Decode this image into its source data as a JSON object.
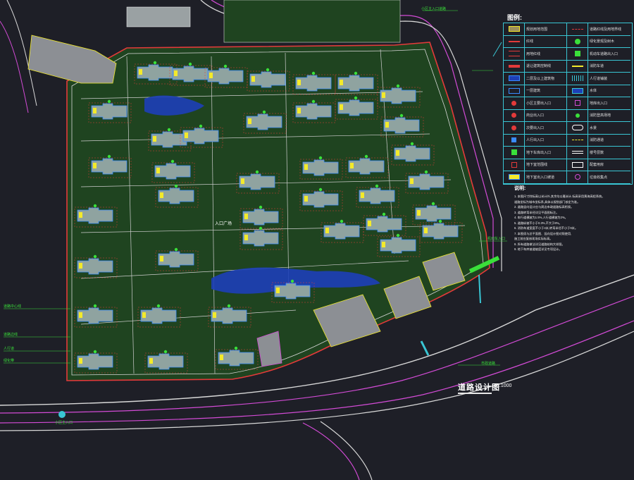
{
  "drawing": {
    "title": "道路设计图",
    "scale": "1:1000"
  },
  "legend": {
    "title": "图例:",
    "rows": [
      {
        "left_symbol": "plot-fill-icon",
        "left_label": "规划用地范围",
        "right_symbol": "dashed-line-icon",
        "right_label": "道路红线及用地界线"
      },
      {
        "left_symbol": "red-line-icon",
        "left_label": "红线",
        "right_symbol": "tree-icon",
        "right_label": "绿化景观及树木"
      },
      {
        "left_symbol": "red-double-line-icon",
        "left_label": "用地红线",
        "right_symbol": "green-arrow-icon",
        "right_label": "机动车道路出入口"
      },
      {
        "left_symbol": "red-fill-bar-icon",
        "left_label": "退让建筑控制线",
        "right_symbol": "yellow-line-icon",
        "right_label": "消防车道"
      },
      {
        "left_symbol": "blue-box-icon",
        "left_label": "二层及以上建筑物",
        "right_symbol": "hatch-fill-icon",
        "right_label": "人行道铺装"
      },
      {
        "left_symbol": "blue-outline-icon",
        "left_label": "一层建筑",
        "right_symbol": "blue-hatch-icon",
        "right_label": "水体"
      },
      {
        "left_symbol": "red-dot-icon",
        "left_label": "小区主要出入口",
        "right_symbol": "purple-square-icon",
        "right_label": "地库出入口"
      },
      {
        "left_symbol": "red-dot-icon",
        "left_label": "商业出入口",
        "right_symbol": "green-mark-icon",
        "right_label": "消防登高场地"
      },
      {
        "left_symbol": "red-dot-icon",
        "left_label": "次要出入口",
        "right_symbol": "cloud-icon",
        "right_label": "水景"
      },
      {
        "left_symbol": "blue-arrow-icon",
        "left_label": "人行出入口",
        "right_symbol": "yellow-dash-icon",
        "right_label": "消防通道"
      },
      {
        "left_symbol": "green-arrow-icon",
        "left_label": "地下车库出入口",
        "right_symbol": "text-sample-icon",
        "right_label": "楼号层数"
      },
      {
        "left_symbol": "red-outline-icon",
        "left_label": "地下室范围线",
        "right_symbol": "white-box-icon",
        "right_label": "配套用房"
      },
      {
        "left_symbol": "yellow-box-icon",
        "left_label": "地下室出入口坡道",
        "right_symbol": "purple-slash-icon",
        "right_label": "垃圾收集点"
      }
    ]
  },
  "notes": {
    "title": "说明:",
    "lines": [
      "1. 本图尺寸除标高以米计外,其余均以毫米计,标高采用黄海高程系统。",
      "   道路坐标为城市坐标系,具体以规划部门核定为准。",
      "2. 道路竖向设计应与周边市政道路标高衔接。",
      "3. 道路转弯半径详见平面图标注。",
      "4. 车行道横坡为1.5%,人行道横坡为2%。",
      "5. 道路纵坡不小于0.3%,不大于8%。",
      "6. 消防车道宽度不小于4米,转弯半径不小于9米。",
      "7. 本图须与总平面图、竖向设计图对照使用,",
      "   施工前应复核现场实际标高。",
      "8. 所有道路做法详见道路结构大样图。",
      "9. 地下车库坡道坡度详见专项设计。"
    ]
  },
  "callouts": {
    "top_road": "小区主入口道路",
    "right_entry": "机动车入口",
    "bottom_right": "市政道路",
    "left_labels": [
      "道路中心线",
      "道路边线",
      "人行道",
      "绿化带"
    ],
    "bottom_entry": "小区主入口",
    "center_label": "入口广场"
  },
  "colors": {
    "background": "#1e1f27",
    "site_ground": "#1f4420",
    "building": "#8fa3a0",
    "redline": "#e33a3a",
    "road_magenta": "#d34bd6",
    "road_white": "#d8d8d8",
    "water": "#1d3fb8",
    "accent_yellow": "#f3ea2b",
    "accent_green": "#3ae03a",
    "legend_border": "#39c6d4"
  }
}
